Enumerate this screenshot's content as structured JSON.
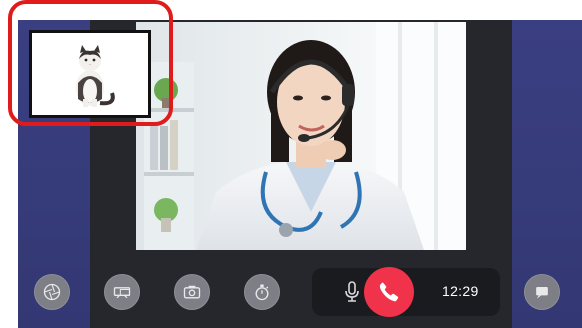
{
  "call": {
    "timer": "12:29"
  },
  "controls": {
    "icons": [
      "shutter-icon",
      "cast-screen-icon",
      "camera-icon",
      "stopwatch-icon",
      "microphone-icon",
      "end-call-phone-icon",
      "chat-icon"
    ]
  },
  "colors": {
    "end_call": "#f0334a",
    "highlight_border": "#e01b1b",
    "side_panel": "#383d7c",
    "background": "#26272d"
  }
}
